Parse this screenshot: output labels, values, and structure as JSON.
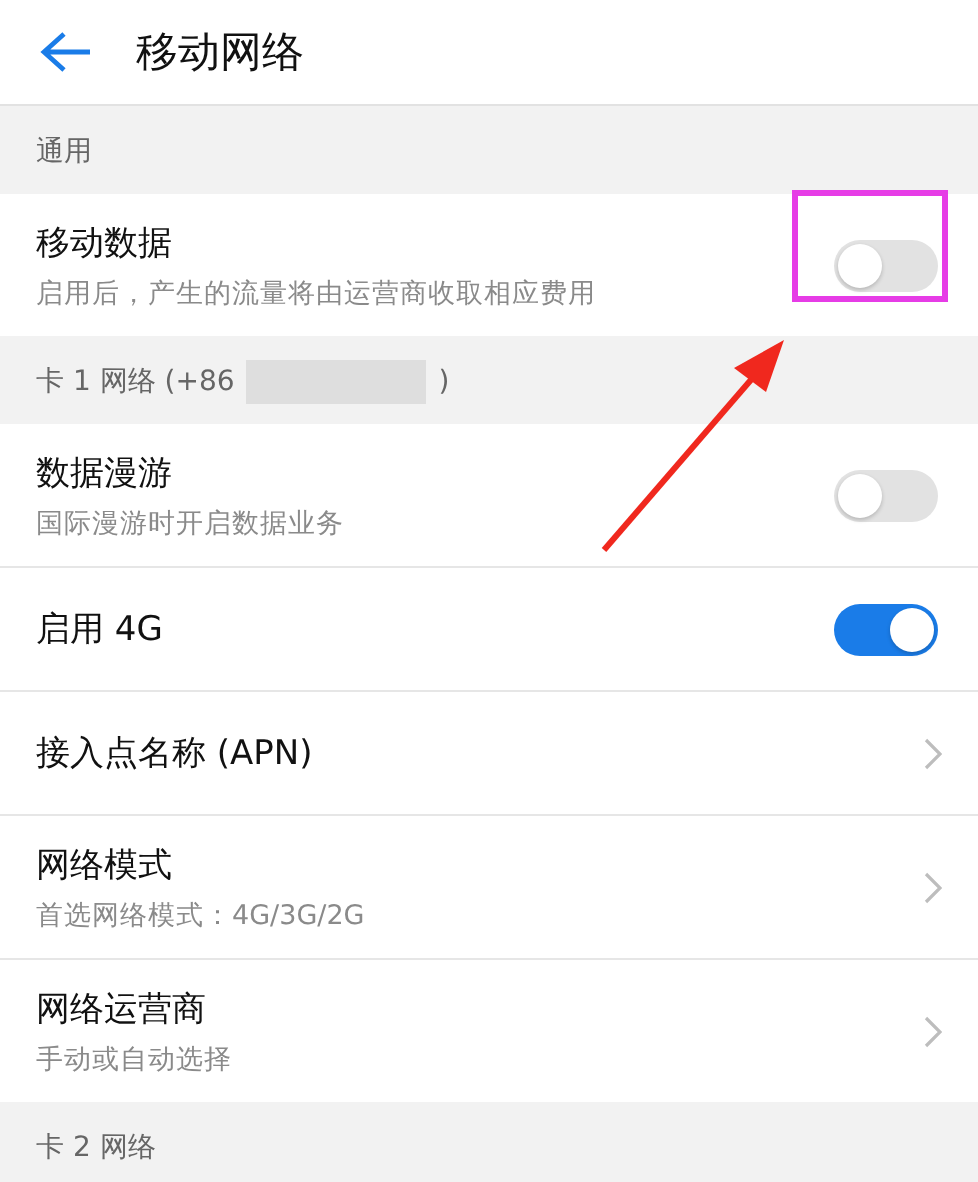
{
  "header": {
    "title": "移动网络"
  },
  "sections": [
    {
      "title": "通用",
      "items": [
        {
          "kind": "toggle",
          "title": "移动数据",
          "subtitle": "启用后，产生的流量将由运营商收取相应费用",
          "on": false,
          "highlighted": true
        }
      ]
    },
    {
      "title": "卡 1 网络 (+86",
      "redacted": true,
      "title_end": ")",
      "items": [
        {
          "kind": "toggle",
          "title": "数据漫游",
          "subtitle": "国际漫游时开启数据业务",
          "on": false
        },
        {
          "kind": "toggle",
          "title": "启用 4G",
          "on": true
        },
        {
          "kind": "link",
          "title": "接入点名称 (APN)"
        },
        {
          "kind": "link",
          "title": "网络模式",
          "subtitle": "首选网络模式：4G/3G/2G"
        },
        {
          "kind": "link",
          "title": "网络运营商",
          "subtitle": "手动或自动选择"
        }
      ]
    },
    {
      "title": "卡 2 网络"
    }
  ]
}
